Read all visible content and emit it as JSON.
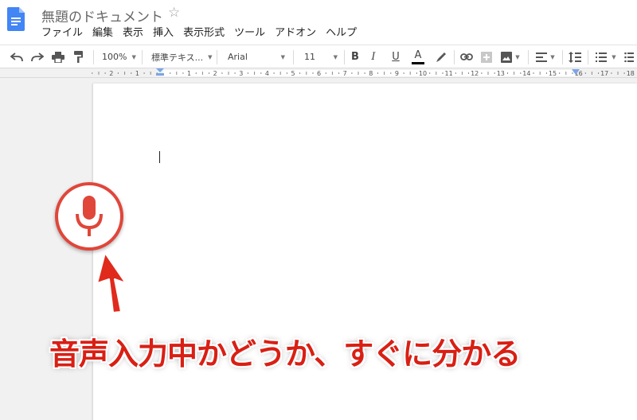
{
  "document": {
    "title": "無題のドキュメント",
    "icon": "docs-logo-icon"
  },
  "menubar": {
    "items": [
      "ファイル",
      "編集",
      "表示",
      "挿入",
      "表示形式",
      "ツール",
      "アドオン",
      "ヘルプ"
    ]
  },
  "toolbar": {
    "zoom": "100%",
    "style": "標準テキス...",
    "font": "Arial",
    "size": "11",
    "bold": "B",
    "italic": "I",
    "underline": "U",
    "text_color_letter": "A",
    "text_color": "#000000"
  },
  "ruler": {
    "labels": [
      "2",
      "1",
      "1",
      "2",
      "3",
      "4",
      "5",
      "6",
      "7",
      "8",
      "9",
      "10",
      "11",
      "12",
      "13",
      "14",
      "15",
      "16",
      "17",
      "18"
    ]
  },
  "overlay": {
    "caption": "音声入力中かどうか、すぐに分かる",
    "accent_color": "#e0463a",
    "mic_icon": "microphone-icon"
  }
}
